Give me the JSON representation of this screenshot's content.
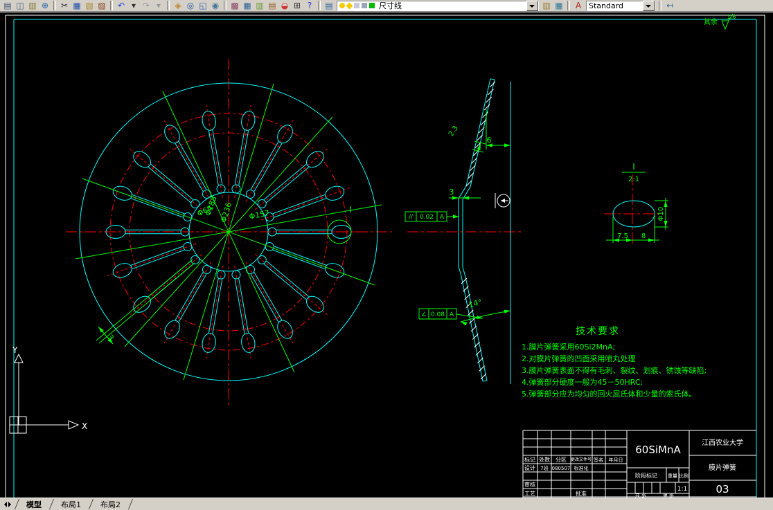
{
  "toolbar": {
    "groups": [
      {
        "icons": [
          {
            "name": "plot-icon",
            "glyph": "▤",
            "color": "#445577"
          },
          {
            "name": "print-preview-icon",
            "glyph": "◫",
            "color": "#445577"
          },
          {
            "name": "publish-icon",
            "glyph": "▥",
            "color": "#887733"
          },
          {
            "name": "etransmit-icon",
            "glyph": "⊕",
            "color": "#2266aa"
          }
        ]
      },
      {
        "icons": [
          {
            "name": "cut-icon",
            "glyph": "✂",
            "color": "#333344"
          },
          {
            "name": "copy-icon",
            "glyph": "▦",
            "color": "#2255aa"
          },
          {
            "name": "paste-ic on",
            "glyph": "▧",
            "color": "#aa8833"
          },
          {
            "name": "match-properties-icon",
            "glyph": "▨",
            "color": "#884422"
          }
        ]
      },
      {
        "icons": [
          {
            "name": "undo-icon",
            "glyph": "↶",
            "color": "#2244cc"
          },
          {
            "name": "undo-dropdown-icon",
            "glyph": "▾",
            "color": "#333333"
          },
          {
            "name": "redo-icon",
            "glyph": "↷",
            "color": "#999999"
          },
          {
            "name": "redo-dropdown-icon",
            "glyph": "▾",
            "color": "#999999"
          }
        ]
      },
      {
        "icons": [
          {
            "name": "pan-icon",
            "glyph": "◈",
            "color": "#bb8833"
          },
          {
            "name": "zoom-realtime-icon",
            "glyph": "◎",
            "color": "#2255aa"
          },
          {
            "name": "zoom-window-icon",
            "glyph": "◱",
            "color": "#2255aa"
          },
          {
            "name": "zoom-previous-icon",
            "glyph": "◉",
            "color": "#447799"
          }
        ]
      },
      {
        "icons": [
          {
            "name": "properties-icon",
            "glyph": "▩",
            "color": "#884466"
          },
          {
            "name": "designcenter-icon",
            "glyph": "▦",
            "color": "#336699"
          },
          {
            "name": "tool-palettes-icon",
            "glyph": "▥",
            "color": "#669933"
          },
          {
            "name": "sheet-set-manager-icon",
            "glyph": "▤",
            "color": "#996633"
          },
          {
            "name": "markup-set-icon",
            "glyph": "◒",
            "color": "#cc3333"
          },
          {
            "name": "quickcalc-icon",
            "glyph": "⊞",
            "color": "#333333"
          },
          {
            "name": "help-icon",
            "glyph": "?",
            "color": "#2233cc"
          }
        ]
      },
      {
        "icons": [
          {
            "name": "layer-properties-icon",
            "glyph": "▤",
            "color": "#336699"
          }
        ]
      },
      {
        "icons": [
          {
            "name": "layer-states-icon",
            "glyph": "▥",
            "color": "#997733"
          },
          {
            "name": "layer-previous-icon",
            "glyph": "▦",
            "color": "#337799"
          }
        ]
      },
      {
        "icons": [
          {
            "name": "text-style-icon",
            "glyph": "A",
            "color": "#aa2222"
          }
        ]
      },
      {
        "icons": [
          {
            "name": "dim-style-icon",
            "glyph": "↤",
            "color": "#336699"
          }
        ]
      }
    ],
    "layer_combo": {
      "value": "尺寸线",
      "icons": [
        {
          "name": "layer-on-bulb-icon",
          "shape": "circle",
          "color": "#f2cc00"
        },
        {
          "name": "layer-freeze-sun-icon",
          "shape": "diamond",
          "color": "#f2cc00"
        },
        {
          "name": "layer-lock-icon",
          "shape": "square",
          "color": "#c8c8d8"
        },
        {
          "name": "layer-plot-icon",
          "shape": "square",
          "color": "#9aa8b8"
        },
        {
          "name": "layer-color-swatch",
          "shape": "square",
          "color": "#00bb00"
        }
      ]
    },
    "style_combo": {
      "value": "Standard"
    }
  },
  "drawing": {
    "front": {
      "dia_outer": "Φ236",
      "dia_holes": "Φ188",
      "dia_inner": "Φ64",
      "dia_mid": "Φ157",
      "slot_width": "3",
      "detail_mark": "I"
    },
    "side": {
      "dim_top": "6",
      "dim_thickness": "3",
      "dim_tip": "2.3",
      "angle": "14°",
      "fcf_parallel": {
        "sym": "//",
        "tol": "0.02",
        "datum": "A"
      },
      "fcf_angular": {
        "sym": "∠",
        "tol": "0.08",
        "datum": "A"
      }
    },
    "detail": {
      "label": "I",
      "scale": "2:1",
      "dim_a": "7.5",
      "dim_b": "8",
      "dim_dia": "Φ10"
    },
    "roughness": {
      "prefix": "其余",
      "value": "1.6"
    },
    "ucs": {
      "x": "X",
      "y": "Y"
    },
    "tech": {
      "title": "技术要求",
      "items": [
        "1.膜片弹簧采用60Si2MnA;",
        "2.对膜片弹簧的凹面采用喷丸处理",
        "3.膜片弹簧表面不得有毛刺、裂纹、划痕、锈蚀等缺陷;",
        "4.弹簧部分硬度一般为45－50HRC;",
        "5.弹簧部分应为均匀的回火屈氏体和少量的索氏体。"
      ]
    },
    "titleblock": {
      "material": "60SiMnA",
      "org": "江西农业大学",
      "part": "膜片弹簧",
      "sheet": "03",
      "scale_value": "1:1",
      "labels": {
        "mark": "标记",
        "count": "处数",
        "zone": "分区",
        "change_file": "更改文件号",
        "sign": "签名",
        "date": "年月日",
        "design": "设计",
        "check": "审核",
        "process": "工艺",
        "approve": "批准",
        "standard": "标准化",
        "stage": "阶段标记",
        "weight": "重量",
        "scale": "比例",
        "total": "共 张",
        "page": "第 张"
      },
      "values": {
        "designer": "7班",
        "design_date": "080507"
      }
    }
  },
  "tabs": [
    {
      "name": "tab-model",
      "label": "模型"
    },
    {
      "name": "tab-layout1",
      "label": "布局1"
    },
    {
      "name": "tab-layout2",
      "label": "布局2"
    }
  ]
}
